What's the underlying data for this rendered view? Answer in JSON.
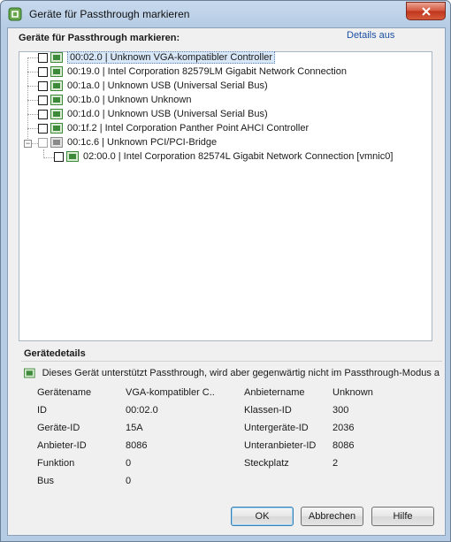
{
  "window": {
    "title": "Geräte für Passthrough markieren"
  },
  "header": {
    "label": "Geräte für Passthrough markieren:",
    "details_link": "Details aus"
  },
  "tree": {
    "items": [
      {
        "text": "00:02.0 | Unknown VGA-kompatibler Controller",
        "checked": false,
        "selected": true
      },
      {
        "text": "00:19.0 | Intel Corporation 82579LM Gigabit Network Connection",
        "checked": false
      },
      {
        "text": "00:1a.0 | Unknown USB (Universal Serial Bus)",
        "checked": false
      },
      {
        "text": "00:1b.0 | Unknown Unknown",
        "checked": false
      },
      {
        "text": "00:1d.0 | Unknown USB (Universal Serial Bus)",
        "checked": false
      },
      {
        "text": "00:1f.2 | Intel Corporation Panther Point AHCI Controller",
        "checked": false
      },
      {
        "text": "00:1c.6 | Unknown PCI/PCI-Bridge",
        "checked": false,
        "expanded": true
      },
      {
        "text": "02:00.0 | Intel Corporation 82574L Gigabit Network Connection [vmnic0]",
        "checked": false,
        "child": true
      }
    ],
    "expander_symbol": "−"
  },
  "details": {
    "heading": "Gerätedetails",
    "message": "Dieses Gerät unterstützt Passthrough, wird aber gegenwärtig nicht im Passthrough-Modus a",
    "left": [
      {
        "label": "Gerätename",
        "value": "VGA-kompatibler C.."
      },
      {
        "label": "ID",
        "value": "00:02.0"
      },
      {
        "label": "Geräte-ID",
        "value": "15A"
      },
      {
        "label": "Anbieter-ID",
        "value": "8086"
      },
      {
        "label": "Funktion",
        "value": "0"
      },
      {
        "label": "Bus",
        "value": "0"
      }
    ],
    "right": [
      {
        "label": "Anbietername",
        "value": "Unknown"
      },
      {
        "label": "Klassen-ID",
        "value": "300"
      },
      {
        "label": "Untergeräte-ID",
        "value": "2036"
      },
      {
        "label": "Unteranbieter-ID",
        "value": "8086"
      },
      {
        "label": "Steckplatz",
        "value": "2"
      }
    ]
  },
  "buttons": {
    "ok": "OK",
    "cancel": "Abbrechen",
    "help": "Hilfe"
  },
  "colors": {
    "accent": "#1b4fa3",
    "close": "#c0341c",
    "device_icon": "#3f8a3a"
  }
}
